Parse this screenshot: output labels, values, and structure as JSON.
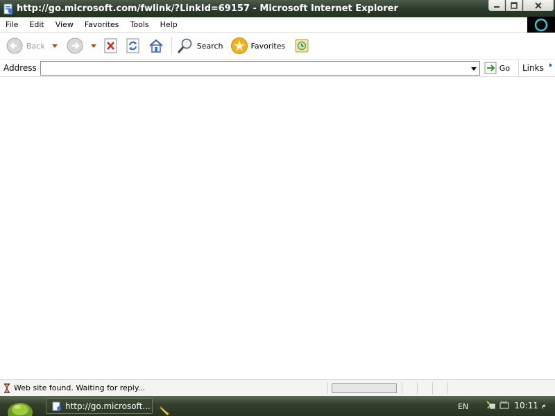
{
  "window": {
    "title": "http://go.microsoft.com/fwlink/?LinkId=69157 - Microsoft Internet Explorer"
  },
  "menu": [
    "File",
    "Edit",
    "View",
    "Favorites",
    "Tools",
    "Help"
  ],
  "toolbar": {
    "back_label": "Back",
    "search_label": "Search",
    "favorites_label": "Favorites"
  },
  "address": {
    "label": "Address",
    "value": "",
    "go_label": "Go",
    "links_label": "Links"
  },
  "status": {
    "text": "Web site found. Waiting for reply...",
    "progress": 0
  },
  "taskbar": {
    "window_button": "http://go.microsoft...",
    "language": "EN",
    "clock": "10:11",
    "ampm": "م"
  },
  "colors": {
    "titlebar": "#2c3a2d",
    "taskbar": "#34412e",
    "accent_blue": "#1b54a8"
  },
  "icons": [
    "ie-page-icon",
    "minimize-icon",
    "maximize-icon",
    "close-icon",
    "windows-flag-icon",
    "back-arrow-icon",
    "forward-arrow-icon",
    "stop-icon",
    "refresh-icon",
    "home-icon",
    "search-icon",
    "favorites-star-icon",
    "history-icon",
    "go-arrow-icon",
    "hourglass-icon",
    "start-orb-icon",
    "network-icon",
    "volume-icon"
  ]
}
